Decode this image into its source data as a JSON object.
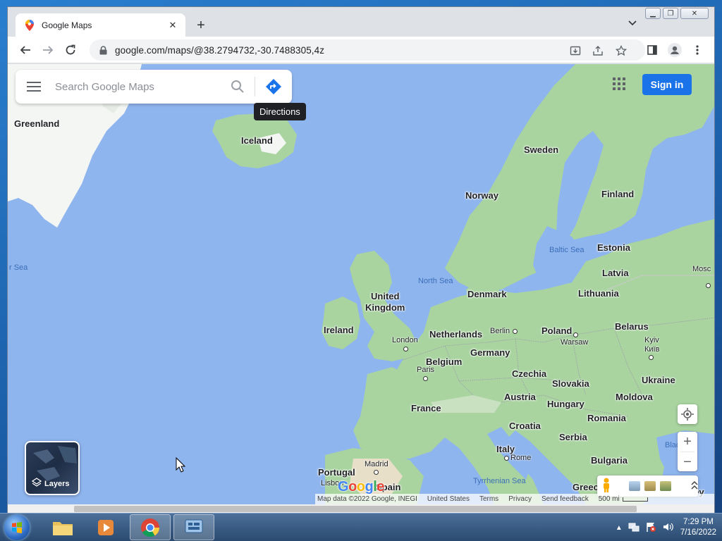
{
  "browser": {
    "tab": {
      "title": "Google Maps"
    },
    "url": "google.com/maps/@38.2794732,-30.7488305,4z"
  },
  "map": {
    "search": {
      "placeholder": "Search Google Maps"
    },
    "directions_tooltip": "Directions",
    "signin_label": "Sign in",
    "layers_label": "Layers",
    "countries": {
      "greenland": "Greenland",
      "iceland": "Iceland",
      "sweden": "Sweden",
      "norway": "Norway",
      "finland": "Finland",
      "estonia": "Estonia",
      "latvia": "Latvia",
      "lithuania": "Lithuania",
      "denmark": "Denmark",
      "uk_line1": "United",
      "uk_line2": "Kingdom",
      "ireland": "Ireland",
      "netherlands": "Netherlands",
      "poland": "Poland",
      "belarus": "Belarus",
      "germany": "Germany",
      "belgium": "Belgium",
      "czechia": "Czechia",
      "slovakia": "Slovakia",
      "ukraine": "Ukraine",
      "france": "France",
      "austria": "Austria",
      "hungary": "Hungary",
      "moldova": "Moldova",
      "croatia": "Croatia",
      "romania": "Romania",
      "serbia": "Serbia",
      "italy": "Italy",
      "bulgaria": "Bulgaria",
      "portugal": "Portugal",
      "spain": "Spain",
      "greece": "Greec",
      "turkey": "Turkey"
    },
    "cities": {
      "london": "London",
      "paris": "Paris",
      "berlin": "Berlin",
      "warsaw": "Warsaw",
      "kyiv": "Kyiv",
      "kyiv_native": "Київ",
      "madrid": "Madrid",
      "lisbon": "Lisbon",
      "rome": "Rome",
      "moscow_partial": "Mosc"
    },
    "seas": {
      "baltic": "Baltic Sea",
      "north": "North Sea",
      "tyrrhenian": "Tyrrhenian Sea",
      "norwegian_partial": "r Sea",
      "black_partial": "Blac"
    },
    "logo": "Google",
    "attribution": {
      "data": "Map data ©2022 Google, INEGI",
      "country": "United States",
      "terms": "Terms",
      "privacy": "Privacy",
      "feedback": "Send feedback",
      "scale": "500 mi"
    }
  },
  "taskbar": {
    "time": "7:29 PM",
    "date": "7/16/2022"
  },
  "colors": {
    "water": "#8fb5ee",
    "land": "#a9d4a0",
    "ice": "#f4f6f4",
    "accent": "#1a73e8"
  }
}
